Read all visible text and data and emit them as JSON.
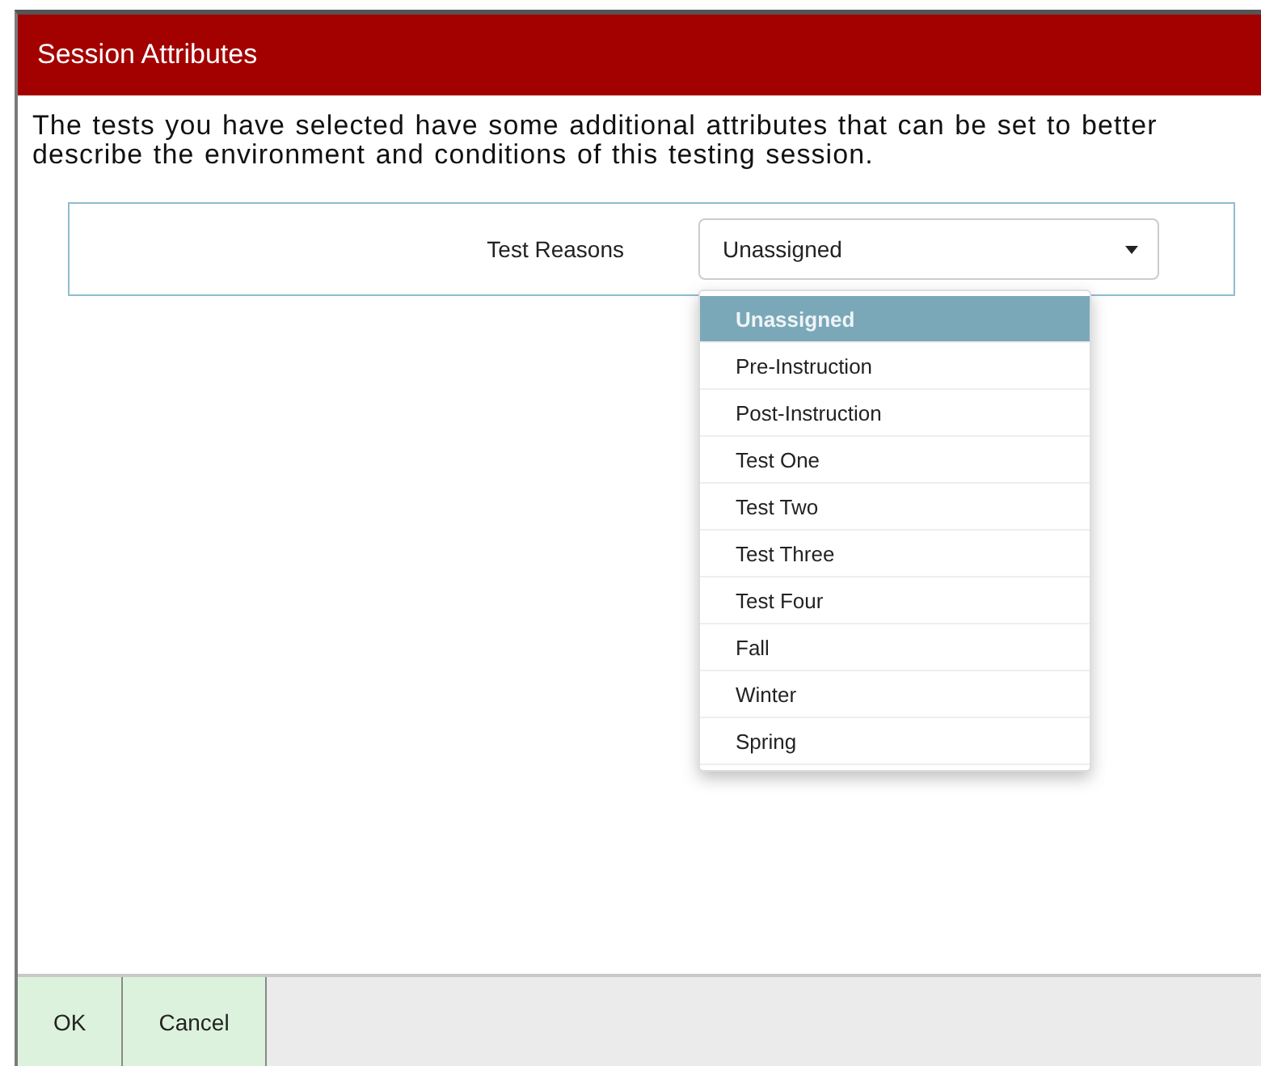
{
  "window": {
    "title": "Session Attributes"
  },
  "description": "The tests you have selected have some additional attributes that can be set to better describe the environment and conditions of this testing session.",
  "field": {
    "label": "Test Reasons",
    "value": "Unassigned",
    "expanded": true,
    "options": [
      {
        "label": "Unassigned",
        "selected": true
      },
      {
        "label": "Pre-Instruction",
        "selected": false
      },
      {
        "label": "Post-Instruction",
        "selected": false
      },
      {
        "label": "Test One",
        "selected": false
      },
      {
        "label": "Test Two",
        "selected": false
      },
      {
        "label": "Test Three",
        "selected": false
      },
      {
        "label": "Test Four",
        "selected": false
      },
      {
        "label": "Fall",
        "selected": false
      },
      {
        "label": "Winter",
        "selected": false
      },
      {
        "label": "Spring",
        "selected": false
      }
    ]
  },
  "buttons": [
    "OK",
    "Cancel"
  ]
}
